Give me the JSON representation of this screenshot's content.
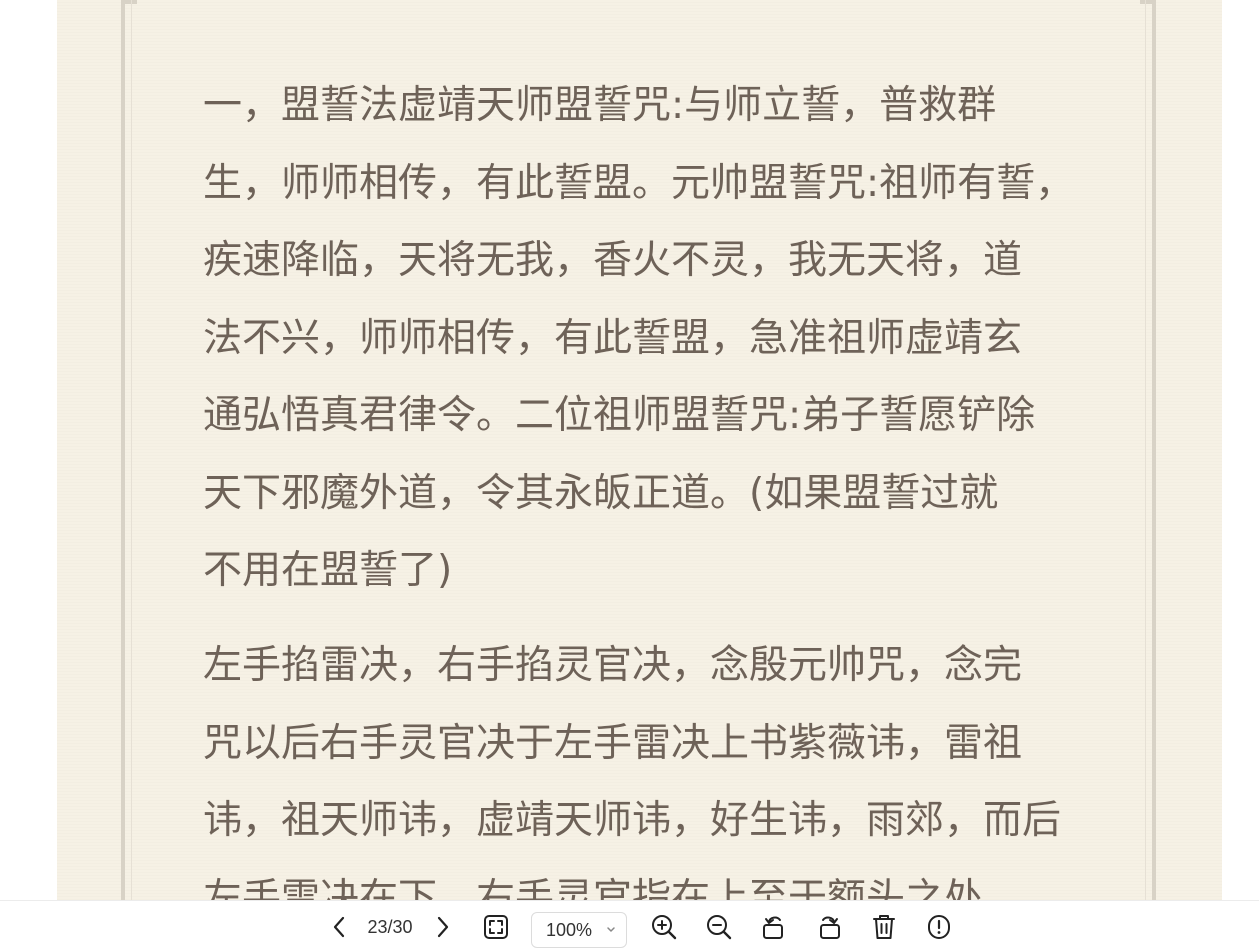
{
  "document": {
    "paragraphs": [
      {
        "lines": [
          "一，盟誓法虚靖天师盟誓咒:与师立誓，普救群",
          "生，师师相传，有此誓盟。元帅盟誓咒:祖师有誓，",
          "疾速降临，天将无我，香火不灵，我无天将，道",
          "法不兴，师师相传，有此誓盟，急准祖师虚靖玄",
          "通弘悟真君律令。二位祖师盟誓咒:弟子誓愿铲除",
          "天下邪魔外道，令其永皈正道。(如果盟誓过就",
          "不用在盟誓了)"
        ]
      },
      {
        "lines": [
          "左手掐雷决，右手掐灵官决，念殷元帅咒，念完",
          "咒以后右手灵官决于左手雷决上书紫薇讳，雷祖",
          "讳，祖天师讳，虚靖天师讳，好生讳，雨郊，而后",
          "左手雷决在下，右手灵官指在上至于额头之处"
        ]
      }
    ],
    "text_color": "#6e6258",
    "background_color": "#f6f1e5"
  },
  "toolbar": {
    "page_indicator": "23/30",
    "zoom": "100%",
    "icons": {
      "prev": "chevron-left-icon",
      "next": "chevron-right-icon",
      "fit": "fit-screen-icon",
      "zoom_in": "zoom-in-icon",
      "zoom_out": "zoom-out-icon",
      "rotate_left": "rotate-left-icon",
      "rotate_right": "rotate-right-icon",
      "delete": "trash-icon",
      "info": "info-icon"
    }
  }
}
